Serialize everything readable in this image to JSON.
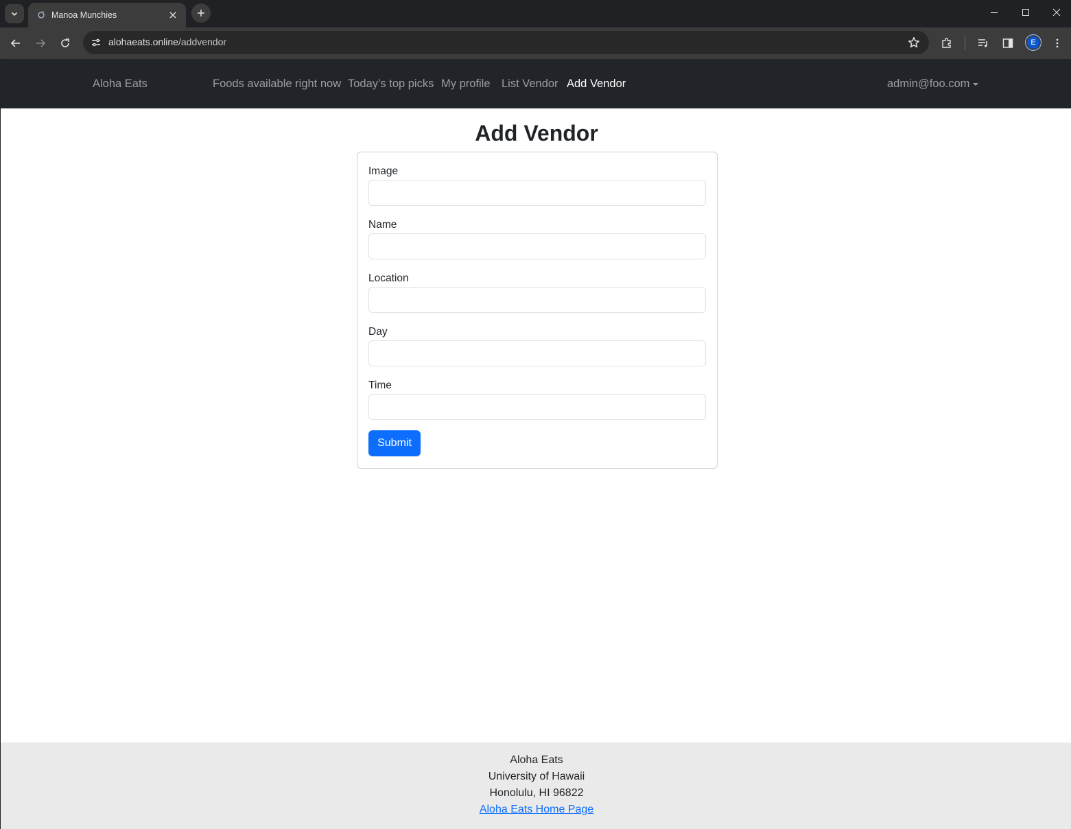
{
  "browser": {
    "tab_title": "Manoa Munchies",
    "url_host": "alohaeats.online",
    "url_path": "/addvendor",
    "profile_initial": "E"
  },
  "navbar": {
    "brand": "Aloha Eats",
    "links": [
      {
        "label": "Foods available right now",
        "active": false
      },
      {
        "label": "Today’s top picks",
        "active": false
      },
      {
        "label": "My profile",
        "active": false
      },
      {
        "label": "List Vendor",
        "active": false
      },
      {
        "label": "Add Vendor",
        "active": true
      }
    ],
    "user": "admin@foo.com"
  },
  "form": {
    "title": "Add Vendor",
    "fields": [
      {
        "label": "Image",
        "value": ""
      },
      {
        "label": "Name",
        "value": ""
      },
      {
        "label": "Location",
        "value": ""
      },
      {
        "label": "Day",
        "value": ""
      },
      {
        "label": "Time",
        "value": ""
      }
    ],
    "submit_label": "Submit"
  },
  "footer": {
    "line1": "Aloha Eats",
    "line2": "University of Hawaii",
    "line3": "Honolulu, HI 96822",
    "link": "Aloha Eats Home Page"
  },
  "colors": {
    "navbar_bg": "#212529",
    "primary": "#0d6efd",
    "footer_bg": "#eaeaea"
  }
}
